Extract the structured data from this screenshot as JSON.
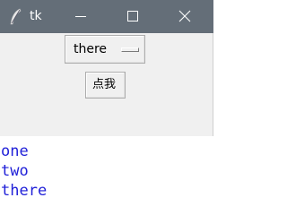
{
  "window": {
    "title": "tk",
    "title_icon": "feather-icon",
    "controls": [
      "minimize-icon",
      "maximize-icon",
      "close-icon"
    ],
    "titlebar_color": "#646e78",
    "body_color": "#f0f0f0"
  },
  "option_menu": {
    "selected": "there"
  },
  "click_button": {
    "label": "点我"
  },
  "console_output": {
    "lines": [
      "one",
      "two",
      "there"
    ],
    "text_color": "#1f1fd8"
  }
}
